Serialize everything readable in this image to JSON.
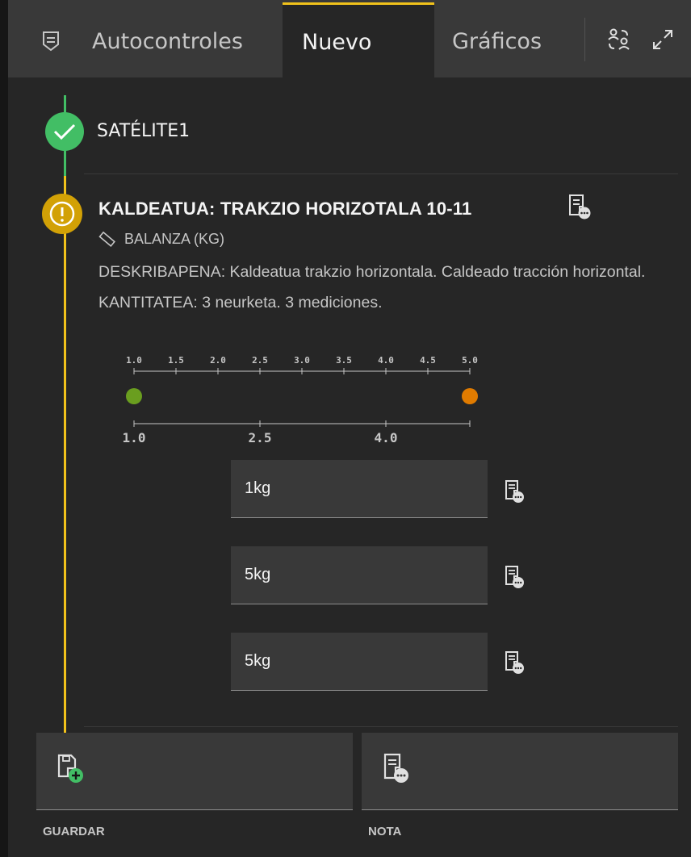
{
  "tabs": [
    {
      "label": "Autocontroles",
      "icon": "form-icon"
    },
    {
      "label": "Nuevo",
      "active": true
    },
    {
      "label": "Gráficos"
    }
  ],
  "toolbar": {
    "icons": [
      "user-switch-icon",
      "maximize-icon"
    ]
  },
  "steps": [
    {
      "title": "SATÉLITE1",
      "status": "complete",
      "color": "#42be65"
    },
    {
      "title": "KALDEATUA: TRAKZIO HORIZOTALA 10-11",
      "status": "warning",
      "color": "#d2a106",
      "instrument": "BALANZA (KG)",
      "description": "DESKRIBAPENA: Kaldeatua trakzio horizontala. Caldeado tracción horizontal. KANTITATEA: 3 neurketa. 3 mediciones."
    }
  ],
  "chart_data": {
    "type": "scatter",
    "top_axis_ticks": [
      "1.0",
      "1.5",
      "2.0",
      "2.5",
      "3.0",
      "3.5",
      "4.0",
      "4.5",
      "5.0"
    ],
    "bottom_axis_ticks": [
      "1.0",
      "2.5",
      "4.0"
    ],
    "points": [
      {
        "value": 1.0,
        "color": "#6a9e1f"
      },
      {
        "value": 5.0,
        "color": "#e07b00"
      }
    ],
    "xlim": [
      1.0,
      5.0
    ]
  },
  "measurements": [
    {
      "value": "1kg"
    },
    {
      "value": "5kg"
    },
    {
      "value": "5kg"
    }
  ],
  "actions": {
    "save_label": "GUARDAR",
    "note_label": "NOTA"
  },
  "colors": {
    "accent_tab": "#f1c21b",
    "success": "#42be65",
    "warning": "#d2a106",
    "add_green": "#42be65"
  }
}
